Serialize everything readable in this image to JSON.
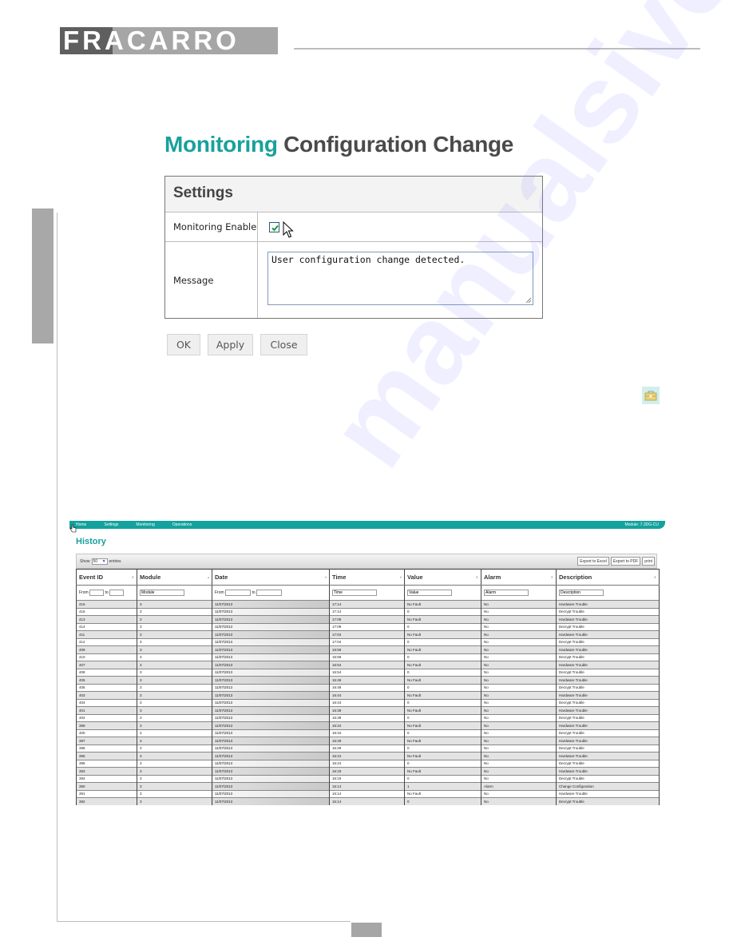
{
  "brand": {
    "logo_text": "FRACARRO"
  },
  "dialog": {
    "title_accent": "Monitoring",
    "title_rest": "Configuration Change",
    "section_title": "Settings",
    "monitoring_enable_label": "Monitoring Enable",
    "monitoring_enabled": true,
    "message_label": "Message",
    "message_value": "User configuration change detected.",
    "buttons": {
      "ok": "OK",
      "apply": "Apply",
      "close": "Close"
    }
  },
  "watermark": "manualsive.com",
  "history": {
    "nav": {
      "items": [
        "Home",
        "Settings",
        "Monitoring",
        "Operations"
      ],
      "module": "Module: 7.3DG-CU"
    },
    "title": "History",
    "show_label": "Show",
    "entries_value": "50",
    "entries_label": "entries",
    "export_buttons": [
      "Export to Excel",
      "Export to PDF",
      "print"
    ],
    "columns": [
      "Event ID",
      "Module",
      "Date",
      "Time",
      "Value",
      "Alarm",
      "Description"
    ],
    "filters": {
      "event_from_label": "From",
      "event_to_label": "to",
      "module_placeholder": "Module",
      "date_from_label": "From",
      "date_to_label": "to",
      "time_placeholder": "Time",
      "value_placeholder": "Value",
      "alarm_placeholder": "Alarm",
      "description_placeholder": "Description"
    },
    "rows": [
      [
        "415",
        "3",
        "11/07/2013",
        "17:14",
        "No Fault",
        "No",
        "Hardware Trouble"
      ],
      [
        "416",
        "3",
        "11/07/2013",
        "17:14",
        "0",
        "No",
        "Decrypt Trouble"
      ],
      [
        "413",
        "3",
        "11/07/2013",
        "17:09",
        "No Fault",
        "No",
        "Hardware Trouble"
      ],
      [
        "414",
        "3",
        "11/07/2013",
        "17:09",
        "0",
        "No",
        "Decrypt Trouble"
      ],
      [
        "411",
        "3",
        "11/07/2013",
        "17:04",
        "No Fault",
        "No",
        "Hardware Trouble"
      ],
      [
        "412",
        "3",
        "11/07/2013",
        "17:04",
        "0",
        "No",
        "Decrypt Trouble"
      ],
      [
        "409",
        "3",
        "11/07/2013",
        "16:59",
        "No Fault",
        "No",
        "Hardware Trouble"
      ],
      [
        "410",
        "3",
        "11/07/2013",
        "16:59",
        "0",
        "No",
        "Decrypt Trouble"
      ],
      [
        "407",
        "3",
        "11/07/2013",
        "16:54",
        "No Fault",
        "No",
        "Hardware Trouble"
      ],
      [
        "408",
        "3",
        "11/07/2013",
        "16:54",
        "0",
        "No",
        "Decrypt Trouble"
      ],
      [
        "405",
        "3",
        "11/07/2013",
        "16:49",
        "No Fault",
        "No",
        "Hardware Trouble"
      ],
      [
        "406",
        "3",
        "11/07/2013",
        "16:49",
        "0",
        "No",
        "Decrypt Trouble"
      ],
      [
        "403",
        "3",
        "11/07/2013",
        "16:44",
        "No Fault",
        "No",
        "Hardware Trouble"
      ],
      [
        "404",
        "3",
        "11/07/2013",
        "16:44",
        "0",
        "No",
        "Decrypt Trouble"
      ],
      [
        "401",
        "3",
        "11/07/2013",
        "16:39",
        "No Fault",
        "No",
        "Hardware Trouble"
      ],
      [
        "402",
        "3",
        "11/07/2013",
        "16:39",
        "0",
        "No",
        "Decrypt Trouble"
      ],
      [
        "399",
        "3",
        "11/07/2013",
        "16:34",
        "No Fault",
        "No",
        "Hardware Trouble"
      ],
      [
        "400",
        "3",
        "11/07/2013",
        "16:34",
        "0",
        "No",
        "Decrypt Trouble"
      ],
      [
        "397",
        "3",
        "11/07/2013",
        "16:29",
        "No Fault",
        "No",
        "Hardware Trouble"
      ],
      [
        "398",
        "3",
        "11/07/2013",
        "16:29",
        "0",
        "No",
        "Decrypt Trouble"
      ],
      [
        "395",
        "3",
        "11/07/2013",
        "16:24",
        "No Fault",
        "No",
        "Hardware Trouble"
      ],
      [
        "396",
        "3",
        "11/07/2013",
        "16:24",
        "0",
        "No",
        "Decrypt Trouble"
      ],
      [
        "393",
        "3",
        "11/07/2013",
        "16:19",
        "No Fault",
        "No",
        "Hardware Trouble"
      ],
      [
        "394",
        "3",
        "11/07/2013",
        "16:19",
        "0",
        "No",
        "Decrypt Trouble"
      ],
      [
        "390",
        "3",
        "11/07/2013",
        "16:14",
        "1",
        "Alarm",
        "Change Configuration"
      ],
      [
        "391",
        "3",
        "11/07/2013",
        "16:14",
        "No Fault",
        "No",
        "Hardware Trouble"
      ],
      [
        "392",
        "3",
        "11/07/2013",
        "16:14",
        "0",
        "No",
        "Decrypt Trouble"
      ]
    ]
  }
}
